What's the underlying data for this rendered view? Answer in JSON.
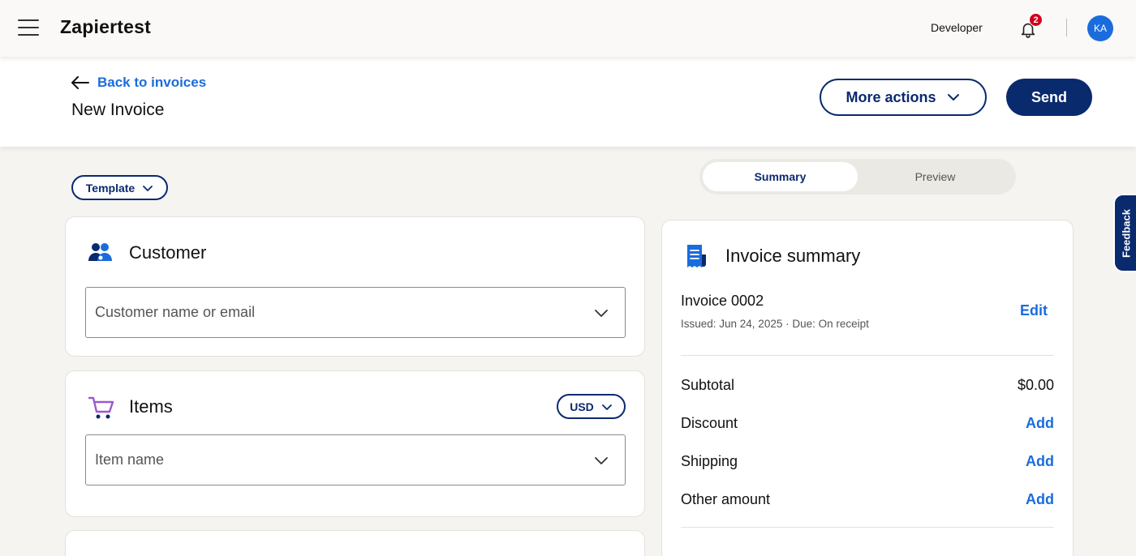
{
  "topbar": {
    "brand": "Zapiertest",
    "developer_label": "Developer",
    "notification_count": "2",
    "avatar_initials": "KA",
    "icons": [
      "hamburger-menu-icon",
      "bell-icon"
    ]
  },
  "header": {
    "back_label": "Back to invoices",
    "title": "New Invoice",
    "more_actions_label": "More actions",
    "send_label": "Send"
  },
  "toolbar": {
    "template_label": "Template"
  },
  "tabs": [
    {
      "label": "Summary",
      "active": true
    },
    {
      "label": "Preview",
      "active": false
    }
  ],
  "customer": {
    "title": "Customer",
    "placeholder": "Customer name or email"
  },
  "items": {
    "title": "Items",
    "currency": "USD",
    "placeholder": "Item name"
  },
  "summary": {
    "title": "Invoice summary",
    "invoice_number": "Invoice 0002",
    "meta": "Issued: Jun 24, 2025  ·  Due: On receipt",
    "edit_label": "Edit",
    "rows": [
      {
        "label": "Subtotal",
        "value": "$0.00"
      },
      {
        "label": "Discount",
        "action": "Add"
      },
      {
        "label": "Shipping",
        "action": "Add"
      },
      {
        "label": "Other amount",
        "action": "Add"
      }
    ]
  },
  "feedback_label": "Feedback",
  "colors": {
    "navy": "#0a2a6e",
    "link_blue": "#1a6cdc",
    "badge_red": "#d0021b",
    "page_bg": "#f5f4f1"
  }
}
